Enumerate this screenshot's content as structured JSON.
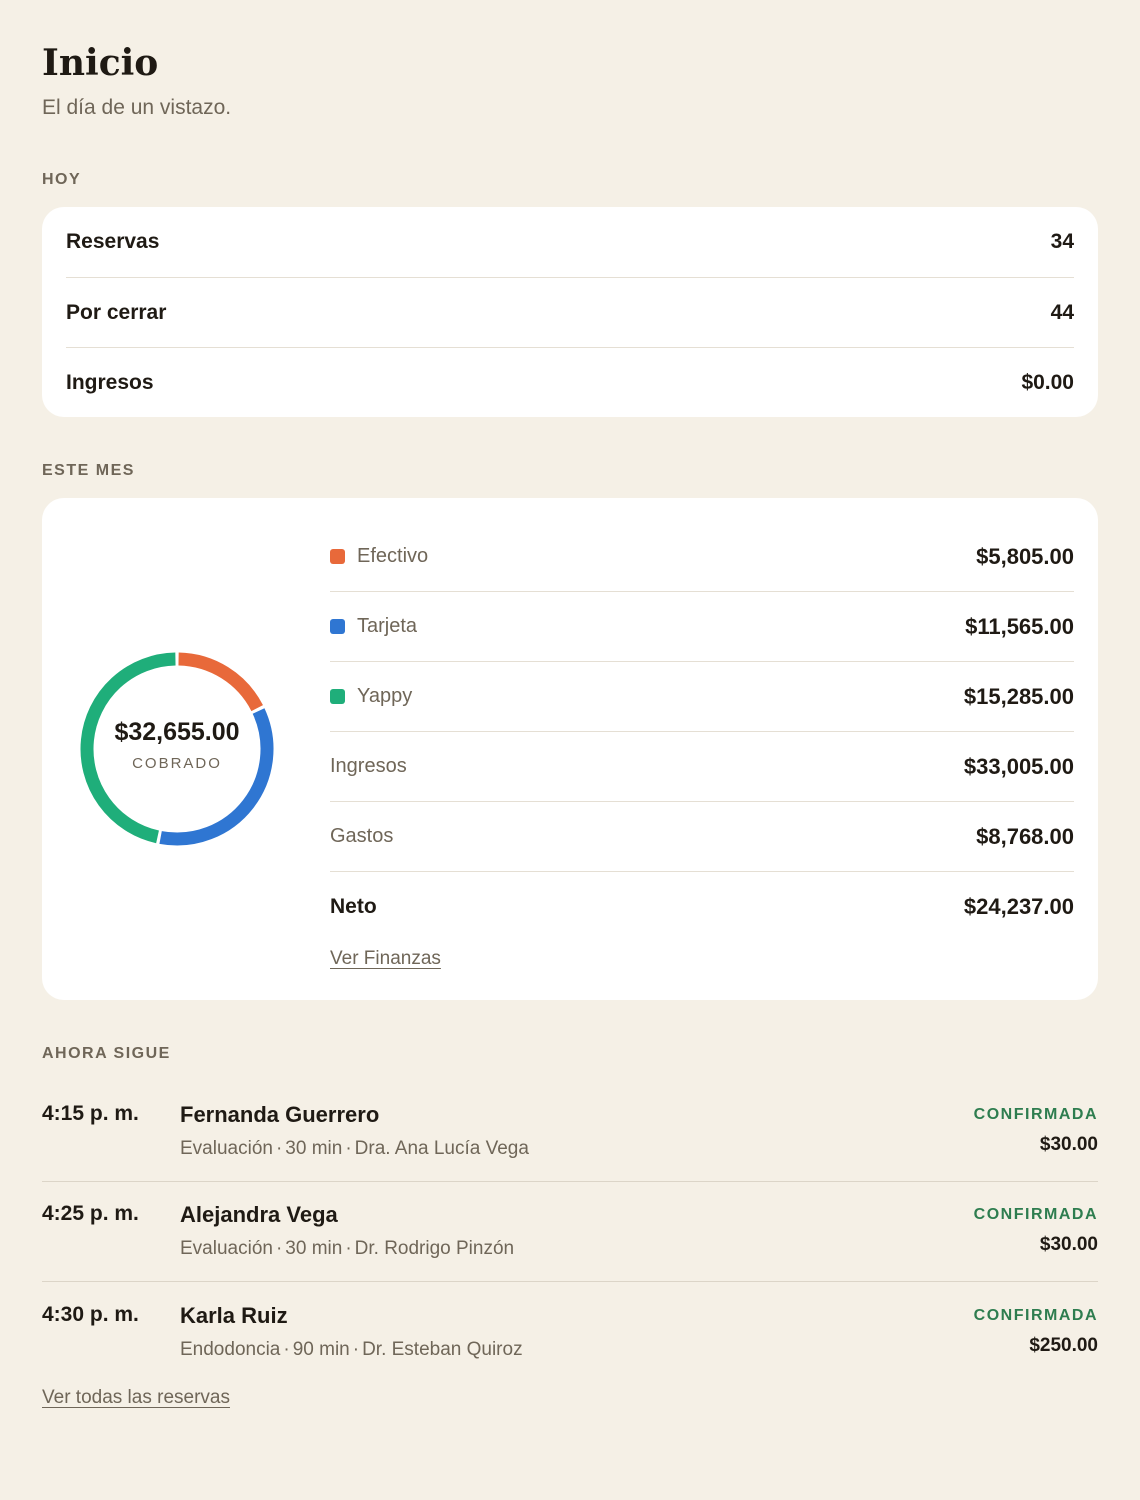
{
  "header": {
    "title": "Inicio",
    "subtitle": "El día de un vistazo."
  },
  "today": {
    "label": "HOY",
    "rows": [
      {
        "label": "Reservas",
        "value": "34"
      },
      {
        "label": "Por cerrar",
        "value": "44"
      },
      {
        "label": "Ingresos",
        "value": "$0.00"
      }
    ]
  },
  "month": {
    "label": "ESTE MES",
    "collected_amount": "$32,655.00",
    "collected_caption": "COBRADO",
    "methods": [
      {
        "label": "Efectivo",
        "value": "$5,805.00",
        "color": "#e8693a"
      },
      {
        "label": "Tarjeta",
        "value": "$11,565.00",
        "color": "#2f76d2"
      },
      {
        "label": "Yappy",
        "value": "$15,285.00",
        "color": "#1fae7a"
      }
    ],
    "summary": [
      {
        "label": "Ingresos",
        "value": "$33,005.00"
      },
      {
        "label": "Gastos",
        "value": "$8,768.00"
      }
    ],
    "net": {
      "label": "Neto",
      "value": "$24,237.00"
    },
    "finance_link": "Ver Finanzas"
  },
  "chart_data": {
    "type": "pie",
    "categories": [
      "Efectivo",
      "Tarjeta",
      "Yappy"
    ],
    "values": [
      5805,
      11565,
      15285
    ],
    "colors": [
      "#e8693a",
      "#2f76d2",
      "#1fae7a"
    ],
    "center_label": "$32,655.00",
    "center_caption": "COBRADO"
  },
  "upcoming": {
    "label": "AHORA SIGUE",
    "items": [
      {
        "time": "4:15 p. m.",
        "name": "Fernanda Guerrero",
        "service": "Evaluación",
        "duration": "30 min",
        "provider": "Dra. Ana Lucía Vega",
        "status": "CONFIRMADA",
        "price": "$30.00"
      },
      {
        "time": "4:25 p. m.",
        "name": "Alejandra Vega",
        "service": "Evaluación",
        "duration": "30 min",
        "provider": "Dr. Rodrigo Pinzón",
        "status": "CONFIRMADA",
        "price": "$30.00"
      },
      {
        "time": "4:30 p. m.",
        "name": "Karla Ruiz",
        "service": "Endodoncia",
        "duration": "90 min",
        "provider": "Dr. Esteban Quiroz",
        "status": "CONFIRMADA",
        "price": "$250.00"
      }
    ],
    "all_link": "Ver todas las reservas"
  }
}
